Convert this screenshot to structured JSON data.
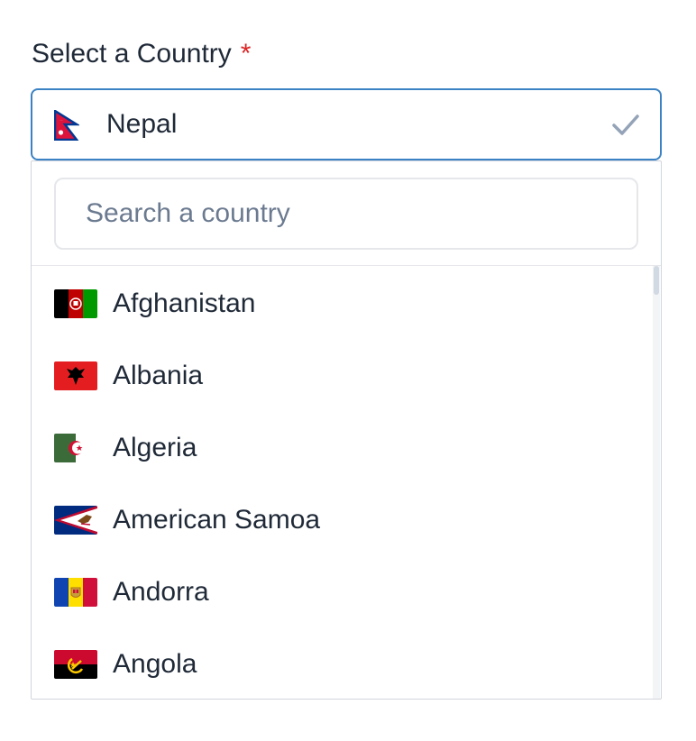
{
  "label": {
    "text": "Select a Country",
    "required_mark": "*"
  },
  "select": {
    "value": "Nepal",
    "flag_icon": "nepal-flag-icon",
    "status_icon": "check-icon"
  },
  "search": {
    "placeholder": "Search a country",
    "value": ""
  },
  "countries": [
    {
      "name": "Afghanistan",
      "flag_icon": "afghanistan-flag-icon"
    },
    {
      "name": "Albania",
      "flag_icon": "albania-flag-icon"
    },
    {
      "name": "Algeria",
      "flag_icon": "algeria-flag-icon"
    },
    {
      "name": "American Samoa",
      "flag_icon": "american-samoa-flag-icon"
    },
    {
      "name": "Andorra",
      "flag_icon": "andorra-flag-icon"
    },
    {
      "name": "Angola",
      "flag_icon": "angola-flag-icon"
    }
  ],
  "colors": {
    "focus_border": "#3b82c4",
    "required": "#dc2626",
    "check": "#94a3b8",
    "text": "#1f2937",
    "placeholder": "#6b7a90"
  }
}
